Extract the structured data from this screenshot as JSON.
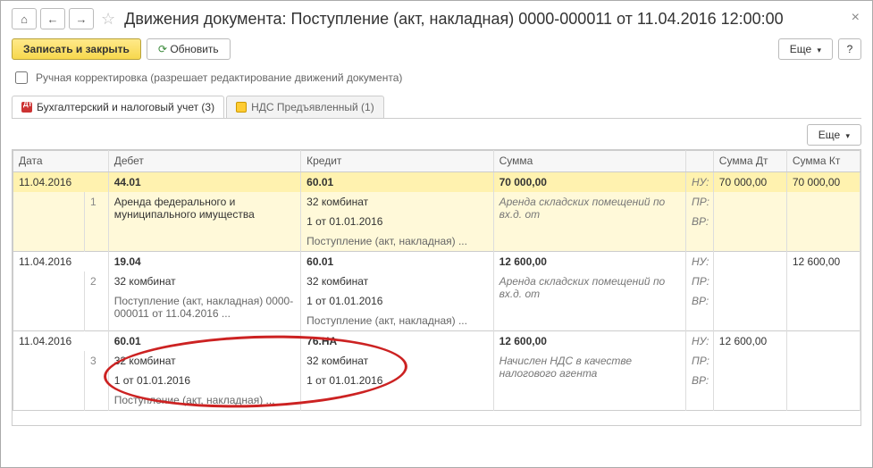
{
  "header": {
    "title": "Движения документа: Поступление (акт, накладная) 0000-000011 от 11.04.2016 12:00:00"
  },
  "toolbar": {
    "save_close": "Записать и закрыть",
    "refresh": "Обновить",
    "more": "Еще"
  },
  "checkbox": {
    "label": "Ручная корректировка (разрешает редактирование движений документа)"
  },
  "tabs": {
    "tab1": "Бухгалтерский и налоговый учет (3)",
    "tab2": "НДС Предъявленный (1)"
  },
  "grid": {
    "headers": {
      "date": "Дата",
      "debit": "Дебет",
      "credit": "Кредит",
      "sum": "Сумма",
      "sum_dt": "Сумма Дт",
      "sum_kt": "Сумма Кт"
    },
    "labels": {
      "nu": "НУ:",
      "pr": "ПР:",
      "vr": "ВР:"
    },
    "rows": [
      {
        "date": "11.04.2016",
        "idx": "1",
        "debit_acc": "44.01",
        "credit_acc": "60.01",
        "sum": "70 000,00",
        "sum_dt": "70 000,00",
        "sum_kt": "70 000,00",
        "debit_sub1": "Аренда федерального и муниципального имущества",
        "credit_sub1": "32 комбинат",
        "credit_sub2": "1 от 01.01.2016",
        "credit_sub3": "Поступление (акт, накладная) ...",
        "desc": "Аренда складских помещений по вх.д. от",
        "hl": true
      },
      {
        "date": "11.04.2016",
        "idx": "2",
        "debit_acc": "19.04",
        "credit_acc": "60.01",
        "sum": "12 600,00",
        "sum_dt": "",
        "sum_kt": "12 600,00",
        "debit_sub1": "32 комбинат",
        "debit_sub2": "Поступление (акт, накладная) 0000-000011 от 11.04.2016 ...",
        "credit_sub1": "32 комбинат",
        "credit_sub2": "1 от 01.01.2016",
        "credit_sub3": "Поступление (акт, накладная) ...",
        "desc": "Аренда складских помещений по вх.д. от",
        "hl": false
      },
      {
        "date": "11.04.2016",
        "idx": "3",
        "debit_acc": "60.01",
        "credit_acc": "76.НА",
        "sum": "12 600,00",
        "sum_dt": "12 600,00",
        "sum_kt": "",
        "debit_sub1": "32 комбинат",
        "debit_sub2": "1 от 01.01.2016",
        "debit_sub3": "Поступление (акт, накладная) ...",
        "credit_sub1": "32 комбинат",
        "credit_sub2": "1 от 01.01.2016",
        "desc": "Начислен НДС в качестве налогового агента",
        "hl": false
      }
    ]
  }
}
